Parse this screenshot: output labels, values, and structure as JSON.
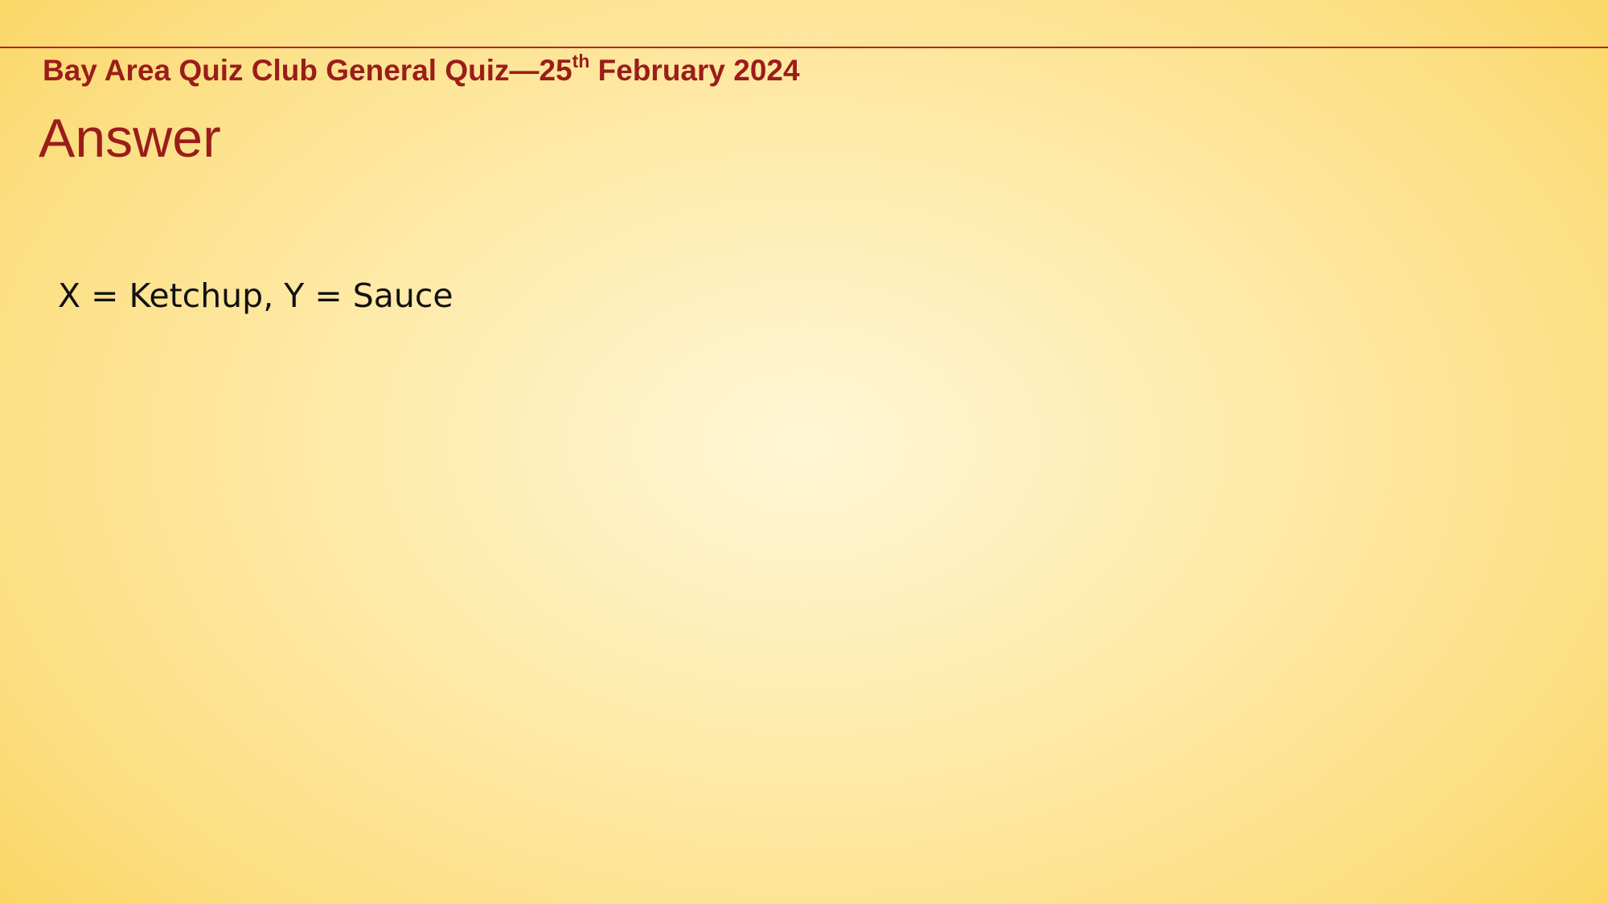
{
  "header": {
    "text_before": "Bay Area Quiz Club General Quiz—25",
    "superscript": "th",
    "text_after": " February 2024"
  },
  "slide": {
    "title": "Answer",
    "answer": "X = Ketchup, Y = Sauce"
  },
  "colors": {
    "accent": "#9b1d1a",
    "rule": "#b5231c",
    "background_center": "#fff6d6",
    "background_edge": "#fbd665"
  }
}
